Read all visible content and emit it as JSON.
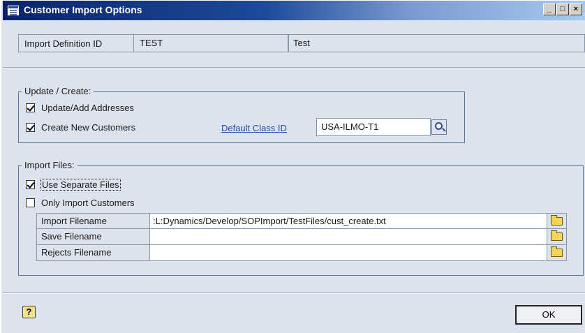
{
  "window": {
    "title": "Customer Import Options",
    "controls": [
      "_",
      "□",
      "×"
    ]
  },
  "import_definition": {
    "label": "Import Definition ID",
    "id": "TEST",
    "description": "Test"
  },
  "update_create": {
    "title": "Update / Create:",
    "update_addresses": {
      "label": "Update/Add Addresses",
      "checked": true
    },
    "create_customers": {
      "label": "Create New Customers",
      "checked": true
    },
    "default_class_link": "Default Class ID",
    "default_class_value": "USA-ILMO-T1"
  },
  "import_files": {
    "title": "Import Files:",
    "use_separate": {
      "label": "Use Separate Files",
      "checked": true
    },
    "only_customers": {
      "label": "Only Import Customers",
      "checked": false
    },
    "rows": [
      {
        "label": "Import Filename",
        "value": ":L:Dynamics/Develop/SOPImport/TestFiles/cust_create.txt"
      },
      {
        "label": "Save Filename",
        "value": ""
      },
      {
        "label": "Rejects Filename",
        "value": ""
      }
    ]
  },
  "footer": {
    "help_glyph": "?",
    "ok_label": "OK"
  },
  "colors": {
    "background": "#dde3ed",
    "titlebar": "#0a246a",
    "link": "#1a4fa0",
    "group_border": "#5d6f9b"
  },
  "icons": [
    "window-app-icon",
    "minimize-icon",
    "maximize-icon",
    "close-icon",
    "lookup-magnifier-icon",
    "folder-icon",
    "help-icon"
  ]
}
